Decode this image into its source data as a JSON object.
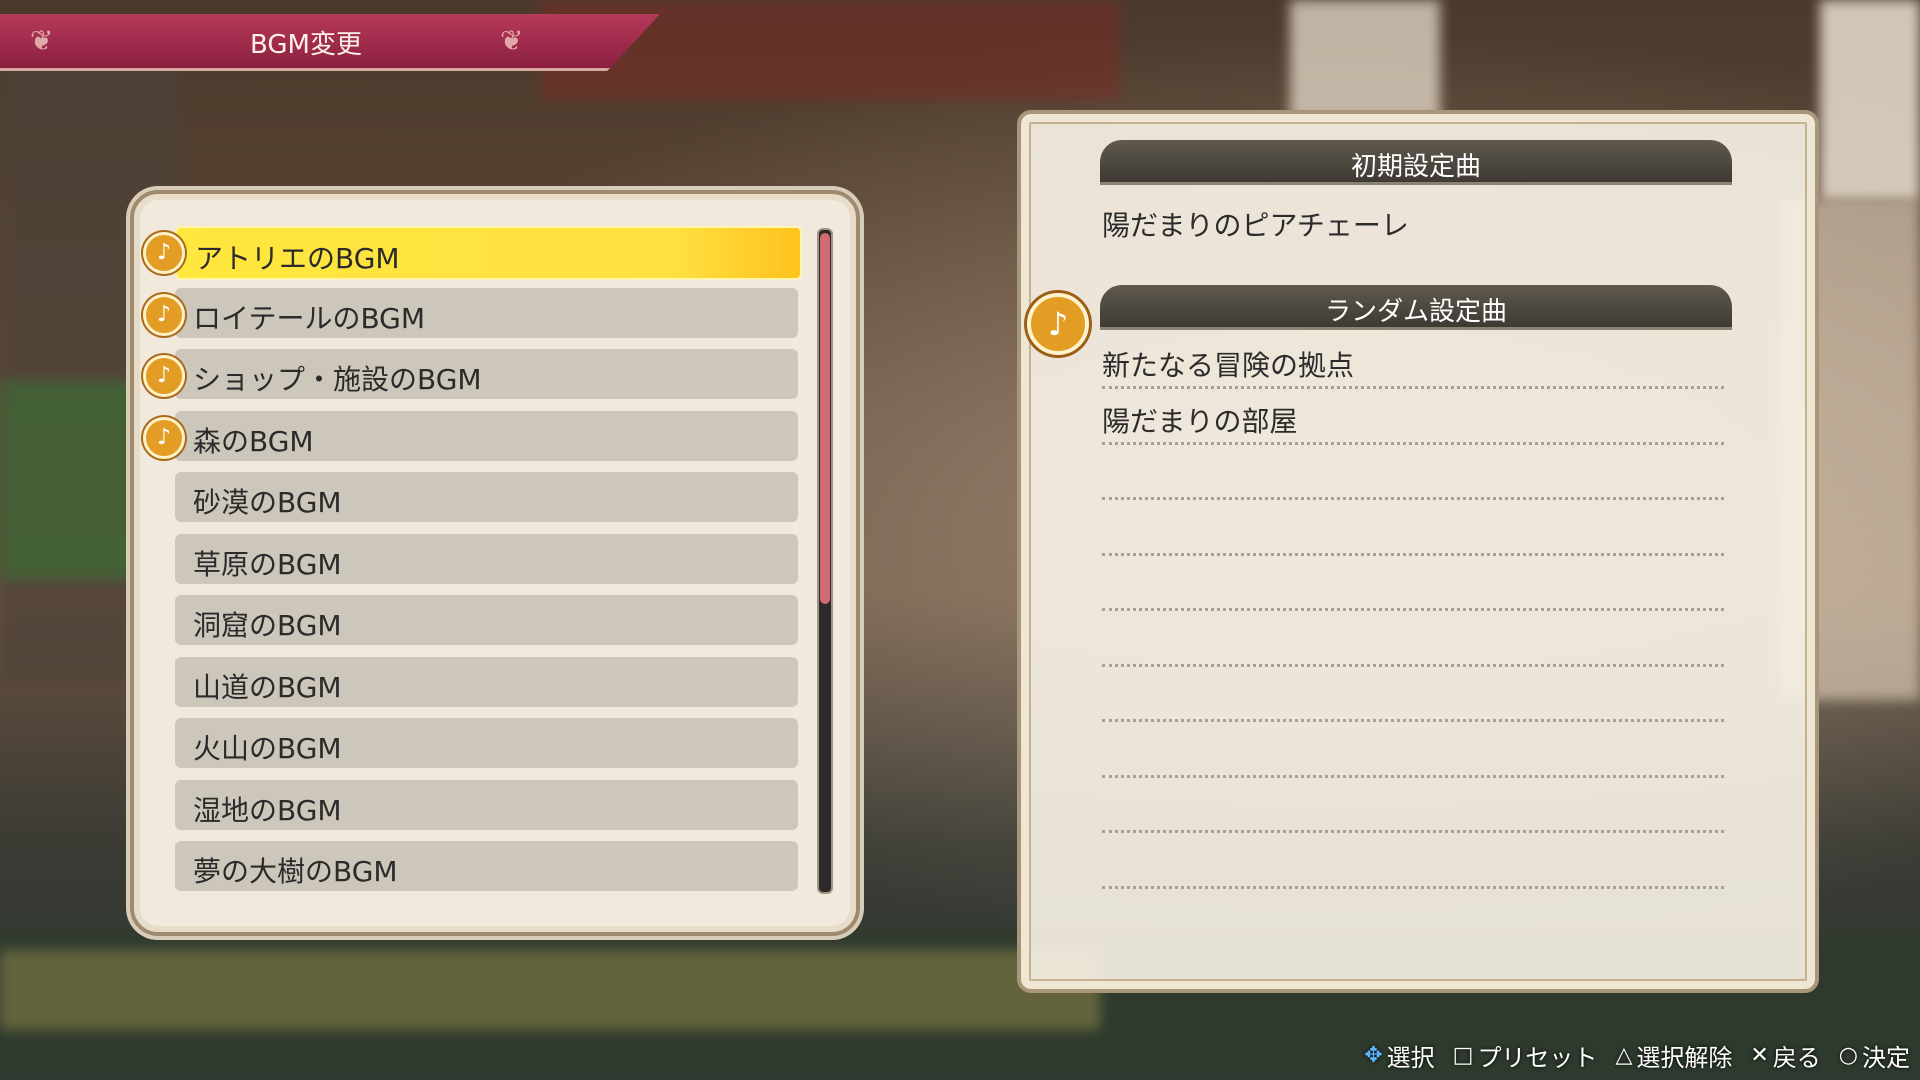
{
  "title": "BGM変更",
  "bgm_list": {
    "items": [
      {
        "label": "アトリエのBGM",
        "has_note": true,
        "selected": true
      },
      {
        "label": "ロイテールのBGM",
        "has_note": true,
        "selected": false
      },
      {
        "label": "ショップ・施設のBGM",
        "has_note": true,
        "selected": false
      },
      {
        "label": "森のBGM",
        "has_note": true,
        "selected": false
      },
      {
        "label": "砂漠のBGM",
        "has_note": false,
        "selected": false
      },
      {
        "label": "草原のBGM",
        "has_note": false,
        "selected": false
      },
      {
        "label": "洞窟のBGM",
        "has_note": false,
        "selected": false
      },
      {
        "label": "山道のBGM",
        "has_note": false,
        "selected": false
      },
      {
        "label": "火山のBGM",
        "has_note": false,
        "selected": false
      },
      {
        "label": "湿地のBGM",
        "has_note": false,
        "selected": false
      },
      {
        "label": "夢の大樹のBGM",
        "has_note": false,
        "selected": false
      }
    ],
    "scroll_fraction_visible": 0.56
  },
  "details": {
    "default_header": "初期設定曲",
    "default_song": "陽だまりのピアチェーレ",
    "random_header": "ランダム設定曲",
    "random_songs": [
      "新たなる冒険の拠点",
      "陽だまりの部屋"
    ]
  },
  "footer": {
    "select_icon": "✥",
    "select_label": "選択",
    "preset_icon": "□",
    "preset_label": "プリセット",
    "deselect_icon": "△",
    "deselect_label": "選択解除",
    "back_icon": "✕",
    "back_label": "戻る",
    "confirm_icon": "○",
    "confirm_label": "決定"
  },
  "colors": {
    "selected": "#ffe040",
    "accent": "#e39c24",
    "banner": "#a52d4e"
  }
}
